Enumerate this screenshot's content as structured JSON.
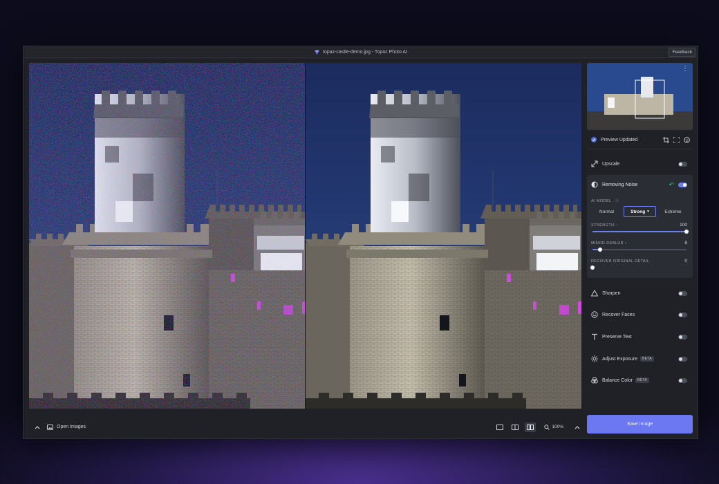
{
  "window": {
    "title": "topaz-castle-demo.jpg - Topaz Photo AI",
    "feedback_label": "Feedback"
  },
  "bottom_bar": {
    "open_images_label": "Open Images",
    "zoom_level": "100%"
  },
  "preview": {
    "status_label": "Preview Updated"
  },
  "panel": {
    "upscale": {
      "label": "Upscale",
      "enabled": false
    },
    "removing_noise": {
      "label": "Removing Noise",
      "enabled": true,
      "ai_model_label": "AI MODEL",
      "models": [
        "Normal",
        "Strong",
        "Extreme"
      ],
      "selected_model": "Strong",
      "strength": {
        "label": "STRENGTH",
        "value": 100,
        "max": 100
      },
      "minor_deblur": {
        "label": "MINOR DEBLUR",
        "value": 8,
        "max": 100
      },
      "recover_detail": {
        "label": "RECOVER ORIGINAL DETAIL",
        "value": 0,
        "max": 100
      }
    },
    "sharpen": {
      "label": "Sharpen",
      "enabled": false
    },
    "recover_faces": {
      "label": "Recover Faces",
      "enabled": false
    },
    "preserve_text": {
      "label": "Preserve Text",
      "enabled": false
    },
    "adjust_exposure": {
      "label": "Adjust Exposure",
      "badge": "BETA",
      "enabled": false
    },
    "balance_color": {
      "label": "Balance Color",
      "badge": "BETA",
      "enabled": false
    },
    "save_label": "Save Image"
  },
  "colors": {
    "accent": "#6b78f2",
    "success": "#45c37b",
    "panel_bg": "#1f2126"
  }
}
